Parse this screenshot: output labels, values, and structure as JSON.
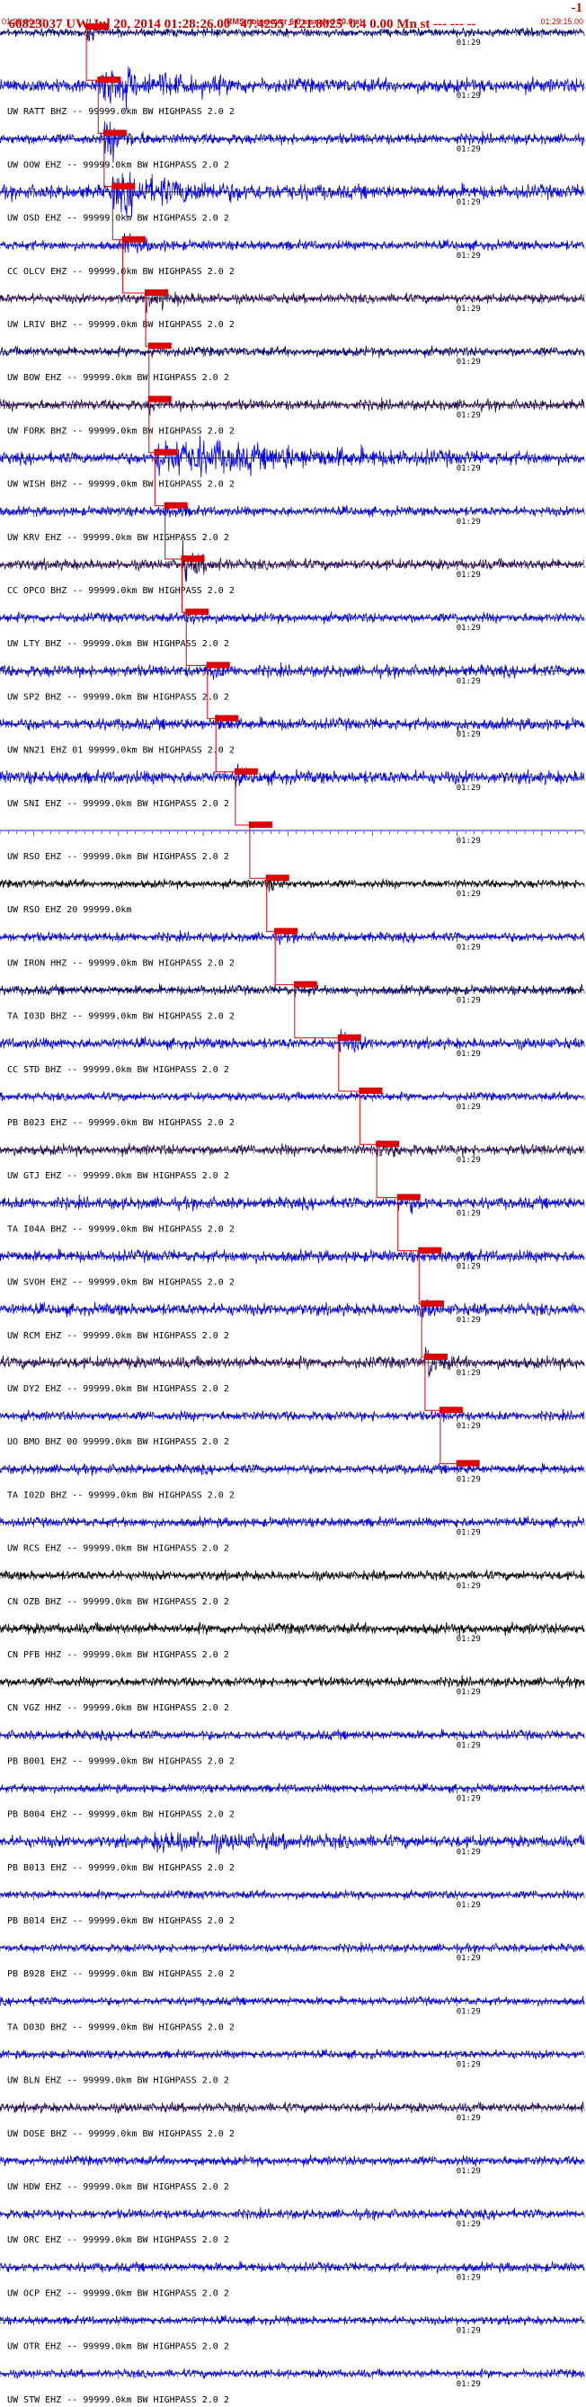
{
  "header": {
    "title": "60823037 UW Jul 20, 2014 01:28:26.00   47.4255 -121.8025  0.4 0.00 Mn st --- --- --",
    "title_right": "-1",
    "start_time": "01:28:06.00",
    "scale_note": "(RMS noise over 6.0 s scaled 20.0 x)",
    "end_time": "01:29:15.00"
  },
  "colors": {
    "accent": "#d40000",
    "pick_box": "#dd0000",
    "trace_blue": "#0000ee",
    "trace_navy": "#000070",
    "trace_purple": "#2a0a55",
    "trace_black": "#000000"
  },
  "chart_data": {
    "type": "line",
    "description_units": "seconds after 01:28:06.00",
    "time_range_s": [
      0,
      69
    ],
    "tick_interval_s": 1,
    "major_tick_label": "01:29",
    "major_tick_time_s": 54,
    "traces": [
      {
        "label": "",
        "color": "navy",
        "amp": 0.35,
        "pick_s": 10.2,
        "event": [
          10.2,
          2,
          1.0
        ]
      },
      {
        "label": "UW RATT BHZ -- 99999.0km BW  HIGHPASS  2.0  2",
        "color": "blue",
        "amp": 0.6,
        "pick_s": 11.6,
        "event": [
          11.6,
          20,
          1.4
        ]
      },
      {
        "label": "UW OOW EHZ -- 99999.0km BW  HIGHPASS  2.0  2",
        "color": "blue",
        "amp": 0.45,
        "pick_s": 12.3,
        "event": [
          12.3,
          6,
          1.5
        ]
      },
      {
        "label": "UW OSD EHZ -- 99999.0km BW  HIGHPASS  2.0  2",
        "color": "blue",
        "amp": 0.6,
        "pick_s": 13.3,
        "event": [
          13.3,
          25,
          1.3
        ]
      },
      {
        "label": "CC OLCV EHZ -- 99999.0km BW  HIGHPASS  2.0  2",
        "color": "blue",
        "amp": 0.4,
        "pick_s": 14.5,
        "event": [
          14.5,
          8,
          0.6
        ]
      },
      {
        "label": "UW LRIV BHZ -- 99999.0km BW  HIGHPASS  2.0  2",
        "color": "purple",
        "amp": 0.4,
        "pick_s": 17.2,
        "event": [
          17.2,
          10,
          0.6
        ]
      },
      {
        "label": "UW BOW EHZ -- 99999.0km BW  HIGHPASS  2.0  2",
        "color": "navy",
        "amp": 0.4,
        "pick_s": 17.6,
        "event": [
          17.6,
          4,
          0.4
        ]
      },
      {
        "label": "UW FORK BHZ -- 99999.0km BW  HIGHPASS  2.0  2",
        "color": "purple",
        "amp": 0.45,
        "pick_s": 17.6,
        "event": [
          17.6,
          4,
          0.4
        ]
      },
      {
        "label": "UW WISH BHZ -- 99999.0km BW  HIGHPASS  2.0  2",
        "color": "blue",
        "amp": 0.5,
        "pick_s": 18.3,
        "event": [
          18.3,
          45,
          1.5
        ]
      },
      {
        "label": "UW KRV EHZ -- 99999.0km BW  HIGHPASS  2.0  2",
        "color": "blue",
        "amp": 0.4,
        "pick_s": 19.5,
        "event": [
          19.5,
          4,
          0.5
        ]
      },
      {
        "label": "CC OPCO BHZ -- 99999.0km BW  HIGHPASS  2.0  2",
        "color": "purple",
        "amp": 0.45,
        "pick_s": 21.5,
        "event": [
          21.5,
          6,
          1.3
        ]
      },
      {
        "label": "UW LTY BHZ -- 99999.0km BW  HIGHPASS  2.0  2",
        "color": "blue",
        "amp": 0.4,
        "pick_s": 22.0,
        "event": [
          22.0,
          4,
          0.5
        ]
      },
      {
        "label": "UW SP2 BHZ -- 99999.0km BW  HIGHPASS  2.0  2",
        "color": "blue",
        "amp": 0.5,
        "pick_s": 24.5,
        "event": [
          24.5,
          3,
          0.6
        ]
      },
      {
        "label": "UW NN21 EHZ 01 99999.0km BW  HIGHPASS  2.0  2",
        "color": "blue",
        "amp": 0.5,
        "pick_s": 25.5,
        "event": [
          25.5,
          3,
          0.5
        ]
      },
      {
        "label": "UW SNI EHZ -- 99999.0km BW  HIGHPASS  2.0  2",
        "color": "blue",
        "amp": 0.55,
        "pick_s": 27.8,
        "event": [
          27.8,
          3,
          0.6
        ]
      },
      {
        "label": "UW RSO EHZ -- 99999.0km BW  HIGHPASS  2.0  2",
        "color": "blue",
        "amp": 0.0,
        "pick_s": 29.5,
        "event": [
          29.5,
          0,
          0
        ]
      },
      {
        "label": "UW RSO EHZ 20 99999.0km",
        "color": "black",
        "amp": 0.35,
        "pick_s": 31.5,
        "event": [
          31.5,
          3,
          0.6
        ]
      },
      {
        "label": "UW IRON HHZ -- 99999.0km BW  HIGHPASS  2.0  2",
        "color": "blue",
        "amp": 0.4,
        "pick_s": 32.5,
        "event": [
          32.5,
          2,
          0.4
        ]
      },
      {
        "label": "TA I03D BHZ -- 99999.0km BW  HIGHPASS  2.0  2",
        "color": "navy",
        "amp": 0.4,
        "pick_s": 34.8,
        "event": [
          34.8,
          3,
          0.4
        ]
      },
      {
        "label": "CC STD BHZ -- 99999.0km BW  HIGHPASS  2.0  2",
        "color": "blue",
        "amp": 0.45,
        "pick_s": 40.0,
        "event": [
          40.0,
          4,
          1.0
        ]
      },
      {
        "label": "PB B023 EHZ -- 99999.0km BW  HIGHPASS  2.0  2",
        "color": "blue",
        "amp": 0.35,
        "pick_s": 42.5,
        "event": [
          42.5,
          2,
          0.3
        ]
      },
      {
        "label": "UW GTJ EHZ -- 99999.0km BW  HIGHPASS  2.0  2",
        "color": "purple",
        "amp": 0.45,
        "pick_s": 44.5,
        "event": [
          44.5,
          5,
          0.7
        ]
      },
      {
        "label": "TA I04A BHZ -- 99999.0km BW  HIGHPASS  2.0  2",
        "color": "blue",
        "amp": 0.5,
        "pick_s": 47.0,
        "event": [
          47.0,
          4,
          0.9
        ]
      },
      {
        "label": "UW SVOH EHZ -- 99999.0km BW  HIGHPASS  2.0  2",
        "color": "blue",
        "amp": 0.5,
        "pick_s": 49.5,
        "event": [
          49.5,
          2,
          0.5
        ]
      },
      {
        "label": "UW RCM EHZ -- 99999.0km BW  HIGHPASS  2.0  2",
        "color": "blue",
        "amp": 0.5,
        "pick_s": 49.8,
        "event": [
          49.8,
          3,
          0.7
        ]
      },
      {
        "label": "UW DY2 EHZ -- 99999.0km BW  HIGHPASS  2.0  2",
        "color": "purple",
        "amp": 0.5,
        "pick_s": 50.2,
        "event": [
          50.2,
          4,
          1.3
        ]
      },
      {
        "label": "UO BMO BHZ 00 99999.0km BW  HIGHPASS  2.0  2",
        "color": "blue",
        "amp": 0.4,
        "pick_s": 52.0,
        "event": [
          52.0,
          2,
          0.4
        ]
      },
      {
        "label": "TA I02D BHZ -- 99999.0km BW  HIGHPASS  2.0  2",
        "color": "blue",
        "amp": 0.4,
        "pick_s": 54.0,
        "event": [
          54.0,
          2,
          0.4
        ]
      },
      {
        "label": "UW RCS EHZ -- 99999.0km BW  HIGHPASS  2.0  2",
        "color": "blue",
        "amp": 0.4,
        "pick_s": null,
        "event": null
      },
      {
        "label": "CN OZB BHZ -- 99999.0km BW  HIGHPASS  2.0  2",
        "color": "black",
        "amp": 0.4,
        "pick_s": null,
        "event": null
      },
      {
        "label": "CN PFB HHZ -- 99999.0km BW  HIGHPASS  2.0  2",
        "color": "black",
        "amp": 0.45,
        "pick_s": null,
        "event": null
      },
      {
        "label": "CN VGZ HHZ -- 99999.0km BW  HIGHPASS  2.0  2",
        "color": "black",
        "amp": 0.4,
        "pick_s": null,
        "event": null
      },
      {
        "label": "PB B001 EHZ -- 99999.0km BW  HIGHPASS  2.0  2",
        "color": "blue",
        "amp": 0.4,
        "pick_s": null,
        "event": null
      },
      {
        "label": "PB B004 EHZ -- 99999.0km BW  HIGHPASS  2.0  2",
        "color": "blue",
        "amp": 0.35,
        "pick_s": null,
        "event": null
      },
      {
        "label": "PB B013 EHZ -- 99999.0km BW  HIGHPASS  2.0  2",
        "color": "blue",
        "amp": 0.5,
        "pick_s": null,
        "event": [
          18.0,
          40,
          0.5
        ]
      },
      {
        "label": "PB B014 EHZ -- 99999.0km BW  HIGHPASS  2.0  2",
        "color": "blue",
        "amp": 0.35,
        "pick_s": null,
        "event": null
      },
      {
        "label": "PB B928 EHZ -- 99999.0km BW  HIGHPASS  2.0  2",
        "color": "blue",
        "amp": 0.35,
        "pick_s": null,
        "event": null
      },
      {
        "label": "TA D03D BHZ -- 99999.0km BW  HIGHPASS  2.0  2",
        "color": "blue",
        "amp": 0.35,
        "pick_s": null,
        "event": null
      },
      {
        "label": "UW BLN EHZ -- 99999.0km BW  HIGHPASS  2.0  2",
        "color": "blue",
        "amp": 0.35,
        "pick_s": null,
        "event": null
      },
      {
        "label": "UW DOSE BHZ -- 99999.0km BW  HIGHPASS  2.0  2",
        "color": "purple",
        "amp": 0.4,
        "pick_s": null,
        "event": null
      },
      {
        "label": "UW HDW EHZ -- 99999.0km BW  HIGHPASS  2.0  2",
        "color": "blue",
        "amp": 0.4,
        "pick_s": null,
        "event": null
      },
      {
        "label": "UW ORC EHZ -- 99999.0km BW  HIGHPASS  2.0  2",
        "color": "blue",
        "amp": 0.4,
        "pick_s": null,
        "event": null
      },
      {
        "label": "UW OCP EHZ -- 99999.0km BW  HIGHPASS  2.0  2",
        "color": "blue",
        "amp": 0.4,
        "pick_s": null,
        "event": null
      },
      {
        "label": "UW OTR EHZ -- 99999.0km BW  HIGHPASS  2.0  2",
        "color": "blue",
        "amp": 0.35,
        "pick_s": null,
        "event": null
      },
      {
        "label": "UW STW EHZ -- 99999.0km BW  HIGHPASS  2.0  2",
        "color": "blue",
        "amp": 0.35,
        "pick_s": null,
        "event": null
      }
    ]
  }
}
